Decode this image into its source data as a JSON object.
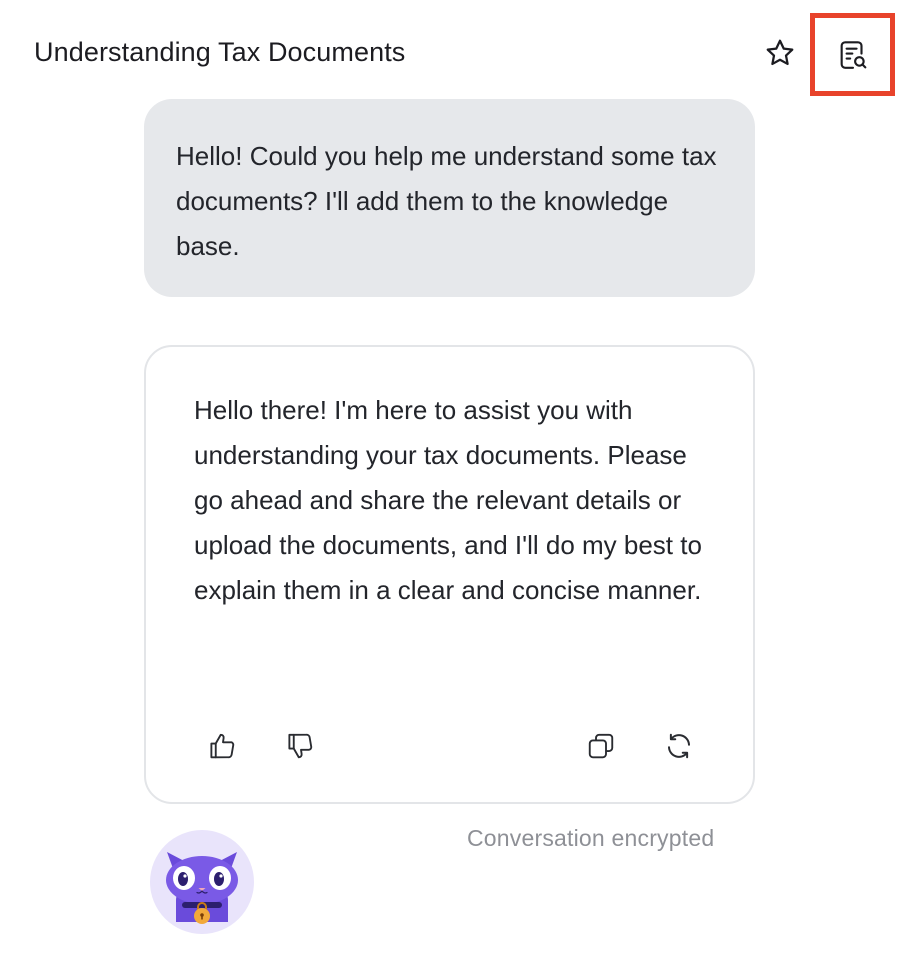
{
  "header": {
    "title": "Understanding Tax Documents",
    "star_icon": "star-icon",
    "knowledge_base_icon": "document-search-icon"
  },
  "messages": [
    {
      "role": "user",
      "text": "Hello! Could you help me understand some tax documents? I'll add them to the knowledge base."
    },
    {
      "role": "assistant",
      "text": "Hello there! I'm here to assist you with understanding your tax documents. Please go ahead and share the relevant details or upload the documents, and I'll do my best to explain them in a clear and concise manner.",
      "actions": [
        "thumbs-up-icon",
        "thumbs-down-icon",
        "copy-icon",
        "regenerate-icon"
      ]
    }
  ],
  "footer": {
    "encrypted_text": "Conversation encrypted",
    "avatar_icon": "cat-mascot-icon"
  },
  "colors": {
    "highlight_border": "#e8432b",
    "user_bubble_bg": "#e6e8eb",
    "card_border": "#e3e5e8",
    "mascot_purple": "#6a4bdb",
    "muted_text": "#8e9096"
  }
}
